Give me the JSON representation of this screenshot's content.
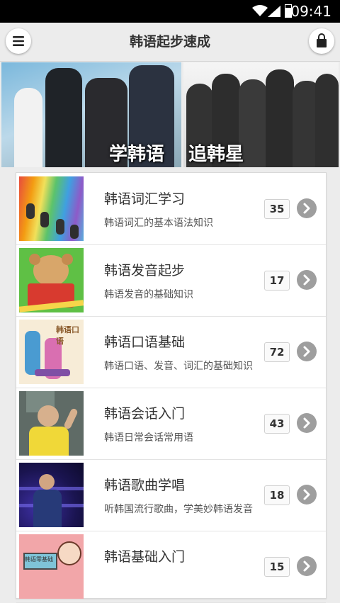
{
  "status_bar": {
    "time": "09:41"
  },
  "app_bar": {
    "title": "韩语起步速成"
  },
  "banner": {
    "left_caption": "学韩语",
    "right_caption": "追韩星"
  },
  "courses": [
    {
      "title": "韩语词汇学习",
      "description": "韩语词汇的基本语法知识",
      "count": "35"
    },
    {
      "title": "韩语发音起步",
      "description": "韩语发音的基础知识",
      "count": "17"
    },
    {
      "title": "韩语口语基础",
      "description": "韩语口语、发音、词汇的基础知识",
      "count": "72"
    },
    {
      "title": "韩语会话入门",
      "description": "韩语日常会话常用语",
      "count": "43"
    },
    {
      "title": "韩语歌曲学唱",
      "description": "听韩国流行歌曲，学美妙韩语发音",
      "count": "18"
    },
    {
      "title": "韩语基础入门",
      "description": "",
      "count": "15"
    }
  ],
  "thumbnail_text": {
    "spoken": "韩语口语",
    "basics": "韩语零基础"
  },
  "icons": {
    "menu": "hamburger-menu-icon",
    "bag": "shopping-bag-icon",
    "arrow": "chevron-right-circle-icon"
  }
}
